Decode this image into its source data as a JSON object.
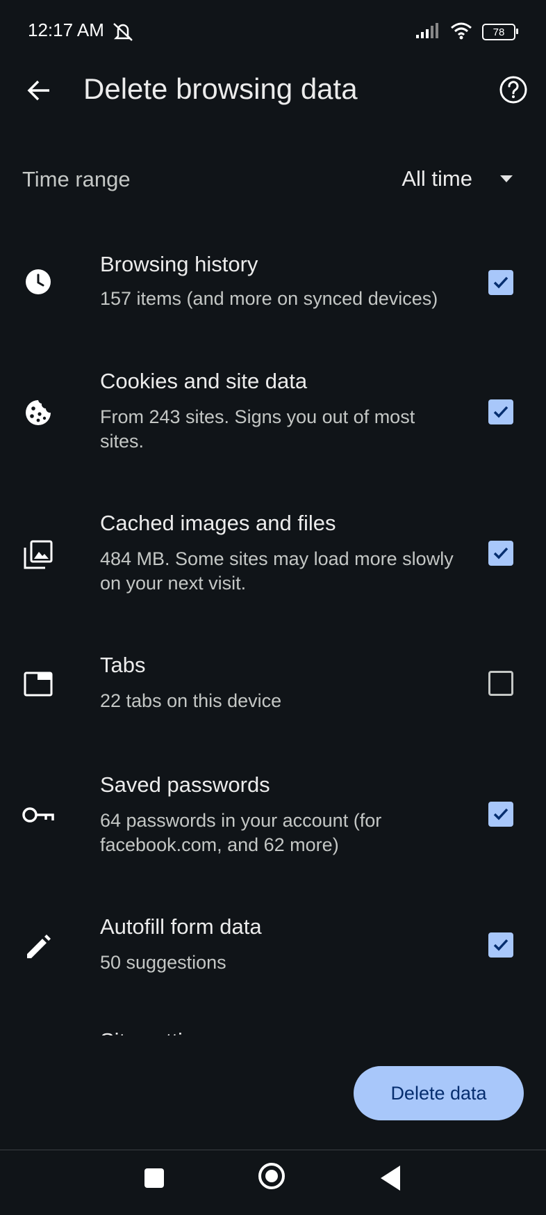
{
  "status_bar": {
    "time": "12:17 AM",
    "battery": "78",
    "icons": [
      "mute-notifications-icon",
      "signal-icon",
      "wifi-icon",
      "battery-icon"
    ]
  },
  "header": {
    "title": "Delete browsing data",
    "back_icon": "arrow-back-icon",
    "help_icon": "help-icon"
  },
  "time_range": {
    "label": "Time range",
    "value": "All time"
  },
  "items": [
    {
      "title": "Browsing history",
      "subtitle": "157 items (and more on synced devices)",
      "icon": "clock-icon",
      "checked": true
    },
    {
      "title": "Cookies and site data",
      "subtitle": "From 243 sites. Signs you out of most sites.",
      "icon": "cookie-icon",
      "checked": true
    },
    {
      "title": "Cached images and files",
      "subtitle": "484 MB. Some sites may load more slowly on your next visit.",
      "icon": "image-library-icon",
      "checked": true
    },
    {
      "title": "Tabs",
      "subtitle": "22 tabs on this device",
      "icon": "tab-icon",
      "checked": false
    },
    {
      "title": "Saved passwords",
      "subtitle": "64 passwords in your account (for facebook.com,  and 62 more)",
      "icon": "key-icon",
      "checked": true
    },
    {
      "title": "Autofill form data",
      "subtitle": "50 suggestions",
      "icon": "pencil-icon",
      "checked": true
    }
  ],
  "clipped_item": {
    "title": "Site settings"
  },
  "actions": {
    "delete_label": "Delete data"
  },
  "colors": {
    "background": "#101418",
    "accent": "#a8c7fa",
    "accent_text": "#062e6f"
  }
}
